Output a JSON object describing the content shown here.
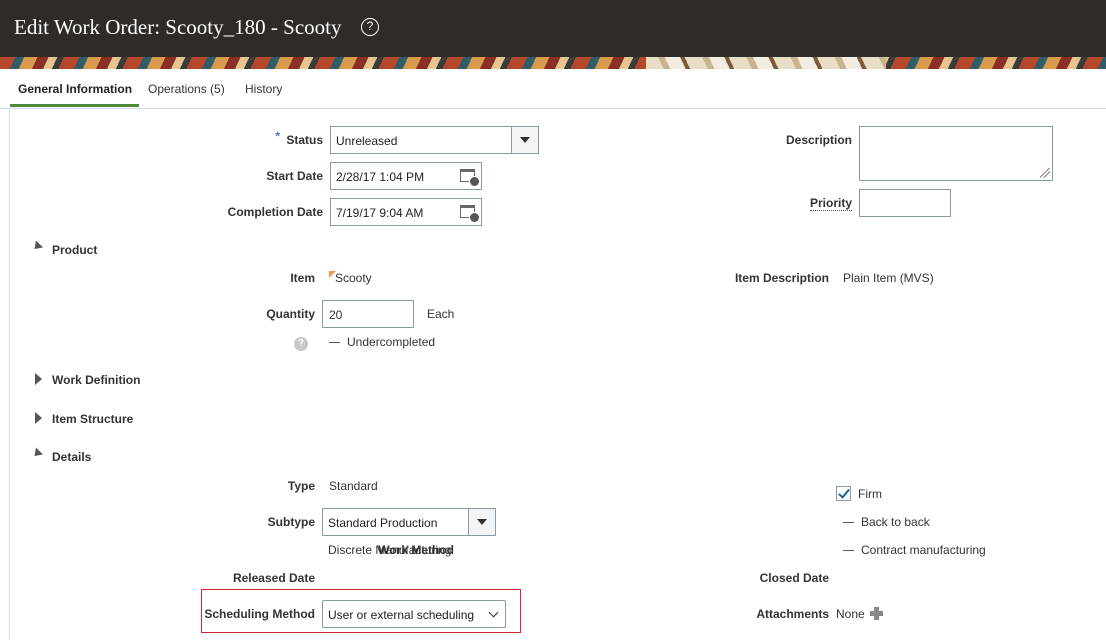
{
  "header": {
    "title": "Edit Work Order: Scooty_180 - Scooty",
    "help_glyph": "?"
  },
  "tabs": [
    {
      "label": "General Information",
      "active": true
    },
    {
      "label": "Operations (5)",
      "active": false
    },
    {
      "label": "History",
      "active": false
    }
  ],
  "general": {
    "required_mark": "*",
    "status_label": "Status",
    "status_value": "Unreleased",
    "start_date_label": "Start Date",
    "start_date_value": "2/28/17 1:04 PM",
    "completion_date_label": "Completion Date",
    "completion_date_value": "7/19/17 9:04 AM",
    "description_label": "Description",
    "description_value": "",
    "priority_label": "Priority",
    "priority_value": ""
  },
  "product": {
    "section_label": "Product",
    "item_label": "Item",
    "item_value": "Scooty",
    "item_description_label": "Item Description",
    "item_description_value": "Plain Item (MVS)",
    "quantity_label": "Quantity",
    "quantity_value": "20",
    "uom": "Each",
    "undercompleted_label": "Undercompleted",
    "help_glyph": "?"
  },
  "work_definition": {
    "section_label": "Work Definition"
  },
  "item_structure": {
    "section_label": "Item Structure"
  },
  "details": {
    "section_label": "Details",
    "type_label": "Type",
    "type_value": "Standard",
    "subtype_label": "Subtype",
    "subtype_value": "Standard Production",
    "work_method_label": "Work Method",
    "work_method_value": "Discrete Manufacturing",
    "released_date_label": "Released Date",
    "scheduling_method_label": "Scheduling Method",
    "scheduling_method_value": "User or external scheduling",
    "firm_label": "Firm",
    "firm_checked": true,
    "back_to_back_label": "Back to back",
    "contract_manufacturing_label": "Contract manufacturing",
    "closed_date_label": "Closed Date",
    "attachments_label": "Attachments",
    "attachments_value": "None"
  },
  "colors": {
    "header_bg": "#302b26",
    "tab_accent": "#4f8a3c",
    "highlight_border": "#d9232d",
    "required": "#1d5f9b"
  }
}
